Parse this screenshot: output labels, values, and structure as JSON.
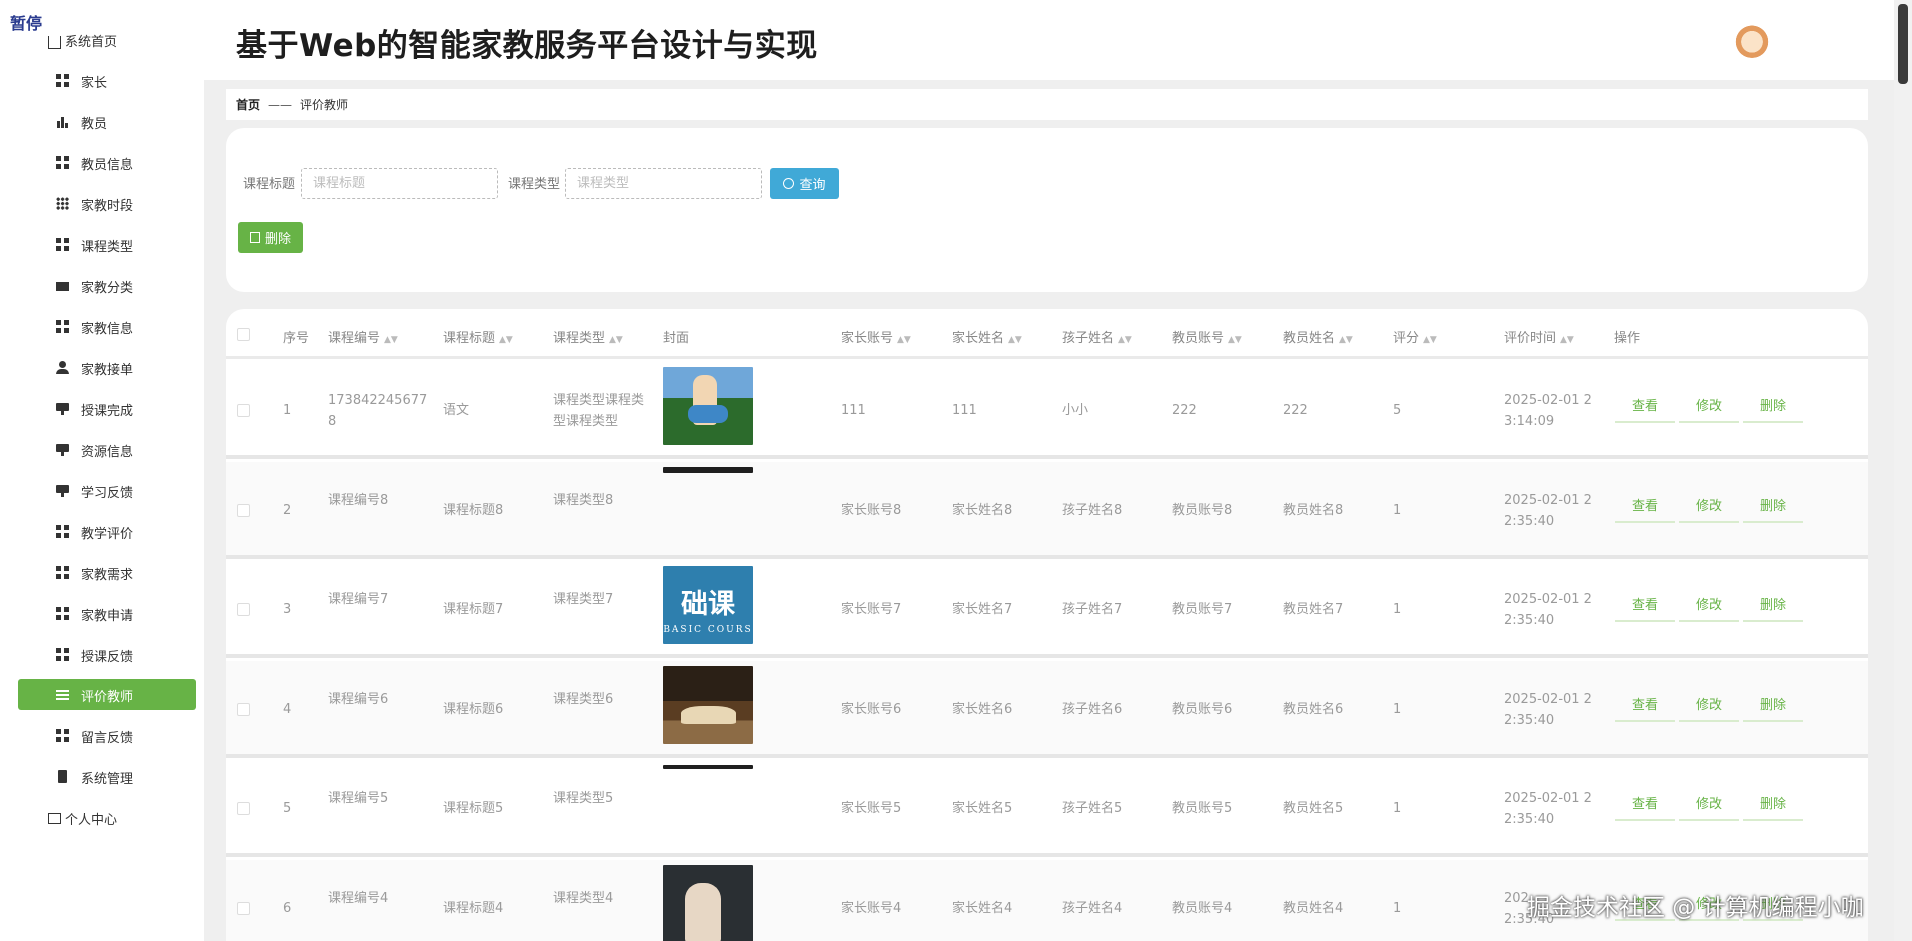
{
  "overlay": {
    "pause_tag": "暂停",
    "watermark": "掘金技术社区 @ 计算机编程小咖"
  },
  "header": {
    "title": "基于Web的智能家教服务平台设计与实现"
  },
  "sidebar": {
    "home": "系统首页",
    "items": [
      {
        "label": "家长",
        "icon": "grid-icon"
      },
      {
        "label": "教员",
        "icon": "bar-chart-icon"
      },
      {
        "label": "教员信息",
        "icon": "grid-icon"
      },
      {
        "label": "家教时段",
        "icon": "grid-nine-icon"
      },
      {
        "label": "课程类型",
        "icon": "grid-icon"
      },
      {
        "label": "家教分类",
        "icon": "briefcase-icon"
      },
      {
        "label": "家教信息",
        "icon": "grid-icon"
      },
      {
        "label": "家教接单",
        "icon": "user-icon"
      },
      {
        "label": "授课完成",
        "icon": "monitor-icon"
      },
      {
        "label": "资源信息",
        "icon": "monitor-icon"
      },
      {
        "label": "学习反馈",
        "icon": "monitor-icon"
      },
      {
        "label": "教学评价",
        "icon": "grid-icon"
      },
      {
        "label": "家教需求",
        "icon": "grid-icon"
      },
      {
        "label": "家教申请",
        "icon": "grid-icon"
      },
      {
        "label": "授课反馈",
        "icon": "grid-icon"
      },
      {
        "label": "评价教师",
        "icon": "sliders-icon"
      },
      {
        "label": "留言反馈",
        "icon": "grid-icon"
      },
      {
        "label": "系统管理",
        "icon": "document-icon"
      }
    ],
    "personal": "个人中心"
  },
  "breadcrumb": {
    "home": "首页",
    "separator": "——",
    "current": "评价教师"
  },
  "search": {
    "title_label": "课程标题",
    "title_placeholder": "课程标题",
    "type_label": "课程类型",
    "type_placeholder": "课程类型",
    "query_button": "查询",
    "delete_button": "删除"
  },
  "table": {
    "headers": [
      "序号",
      "课程编号",
      "课程标题",
      "课程类型",
      "封面",
      "家长账号",
      "家长姓名",
      "孩子姓名",
      "教员账号",
      "教员姓名",
      "评分",
      "评价时间",
      "操作"
    ],
    "actions": {
      "view": "查看",
      "edit": "修改",
      "delete": "删除"
    },
    "rows": [
      {
        "no": "1",
        "code": "173842245677\n8",
        "title": "语文",
        "type": "课程类型课程类\n型课程类型",
        "parent_acc": "111",
        "parent_name": "111",
        "child": "小小",
        "teacher_acc": "222",
        "teacher_name": "222",
        "score": "5",
        "time": "2025-02-01 2\n3:14:09"
      },
      {
        "no": "2",
        "code": "课程编号8",
        "title": "课程标题8",
        "type": "课程类型8",
        "parent_acc": "家长账号8",
        "parent_name": "家长姓名8",
        "child": "孩子姓名8",
        "teacher_acc": "教员账号8",
        "teacher_name": "教员姓名8",
        "score": "1",
        "time": "2025-02-01 2\n2:35:40"
      },
      {
        "no": "3",
        "code": "课程编号7",
        "title": "课程标题7",
        "type": "课程类型7",
        "parent_acc": "家长账号7",
        "parent_name": "家长姓名7",
        "child": "孩子姓名7",
        "teacher_acc": "教员账号7",
        "teacher_name": "教员姓名7",
        "score": "1",
        "time": "2025-02-01 2\n2:35:40",
        "cover_text": "础课",
        "cover_sub": "BASIC COURS"
      },
      {
        "no": "4",
        "code": "课程编号6",
        "title": "课程标题6",
        "type": "课程类型6",
        "parent_acc": "家长账号6",
        "parent_name": "家长姓名6",
        "child": "孩子姓名6",
        "teacher_acc": "教员账号6",
        "teacher_name": "教员姓名6",
        "score": "1",
        "time": "2025-02-01 2\n2:35:40"
      },
      {
        "no": "5",
        "code": "课程编号5",
        "title": "课程标题5",
        "type": "课程类型5",
        "parent_acc": "家长账号5",
        "parent_name": "家长姓名5",
        "child": "孩子姓名5",
        "teacher_acc": "教员账号5",
        "teacher_name": "教员姓名5",
        "score": "1",
        "time": "2025-02-01 2\n2:35:40"
      },
      {
        "no": "6",
        "code": "课程编号4",
        "title": "课程标题4",
        "type": "课程类型4",
        "parent_acc": "家长账号4",
        "parent_name": "家长姓名4",
        "child": "孩子姓名4",
        "teacher_acc": "教员账号4",
        "teacher_name": "教员姓名4",
        "score": "1",
        "time": "202\n2:35:40"
      }
    ]
  },
  "colors": {
    "accent_green": "#67b346",
    "query_blue": "#40a9d7"
  }
}
